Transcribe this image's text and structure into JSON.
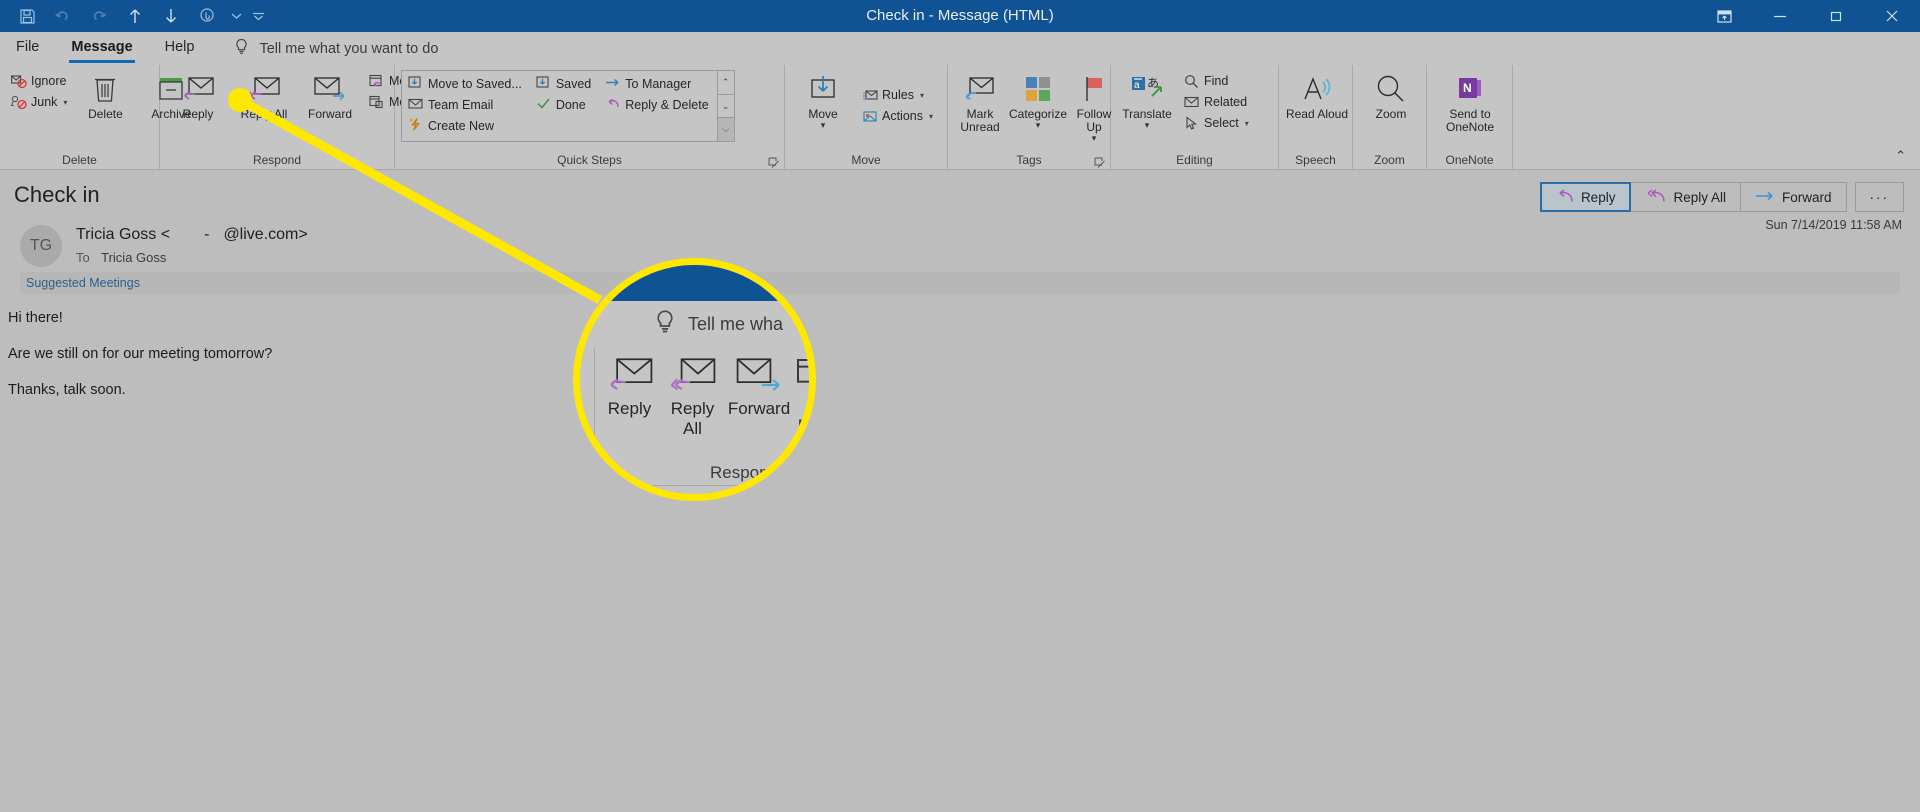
{
  "window": {
    "title": "Check in  -  Message (HTML)",
    "quick_access": [
      {
        "name": "save-icon",
        "label": "Save"
      },
      {
        "name": "undo-icon",
        "label": "Undo"
      },
      {
        "name": "redo-icon",
        "label": "Redo"
      },
      {
        "name": "previous-item-icon",
        "label": "Previous Item"
      },
      {
        "name": "next-item-icon",
        "label": "Next Item"
      },
      {
        "name": "touch-mode-icon",
        "label": "Touch/Mouse Mode"
      }
    ],
    "controls": [
      {
        "name": "ribbon-display-options-button",
        "label": "Ribbon Display Options"
      },
      {
        "name": "minimize-button",
        "label": "Minimize"
      },
      {
        "name": "maximize-button",
        "label": "Maximize"
      },
      {
        "name": "close-button",
        "label": "Close"
      }
    ]
  },
  "tabs": [
    {
      "label": "File",
      "active": false
    },
    {
      "label": "Message",
      "active": true
    },
    {
      "label": "Help",
      "active": false
    }
  ],
  "tellme": {
    "placeholder": "Tell me what you want to do",
    "icon": "lightbulb-icon"
  },
  "ribbon": {
    "collapse_label": "⌃",
    "groups": [
      {
        "label": "Delete",
        "small_buttons": [
          {
            "label": "Ignore",
            "icon": "ignore-icon",
            "caret": false
          },
          {
            "label": "Junk",
            "icon": "junk-icon",
            "caret": true
          }
        ],
        "big_buttons": [
          {
            "label": "Delete",
            "icon": "trash-icon",
            "caret": false
          },
          {
            "label": "Archive",
            "icon": "archive-icon",
            "caret": false
          }
        ]
      },
      {
        "label": "Respond",
        "big_buttons": [
          {
            "label": "Reply",
            "icon": "reply-envelope-icon",
            "caret": false
          },
          {
            "label": "Reply All",
            "icon": "reply-all-envelope-icon",
            "caret": false
          },
          {
            "label": "Forward",
            "icon": "forward-envelope-icon",
            "caret": false
          }
        ],
        "small_buttons": [
          {
            "label": "Meeting",
            "icon": "meeting-calendar-icon",
            "caret": false
          },
          {
            "label": "More",
            "icon": "more-calendar-icon",
            "caret": true
          }
        ]
      },
      {
        "label": "Quick Steps",
        "gallery_column_1": [
          {
            "label": "Move to Saved...",
            "icon": "move-to-folder-icon"
          },
          {
            "label": "Team Email",
            "icon": "envelope-icon"
          },
          {
            "label": "Create New",
            "icon": "create-new-lightning-icon"
          }
        ],
        "gallery_column_2": [
          {
            "label": "Saved",
            "icon": "move-to-folder-icon"
          },
          {
            "label": "Done",
            "icon": "checkmark-icon"
          }
        ],
        "gallery_column_3": [
          {
            "label": "To Manager",
            "icon": "arrow-right-icon"
          },
          {
            "label": "Reply & Delete",
            "icon": "reply-delete-icon"
          }
        ],
        "scroll": [
          "⌃",
          "⌄",
          "⌵"
        ],
        "has_launcher": true
      },
      {
        "label": "Move",
        "big_buttons": [
          {
            "label": "Move",
            "icon": "move-folder-icon",
            "caret": true
          }
        ],
        "small_buttons": [
          {
            "label": "Rules",
            "icon": "rules-icon",
            "caret": true
          },
          {
            "label": "Actions",
            "icon": "actions-icon",
            "caret": true
          }
        ]
      },
      {
        "label": "Tags",
        "big_buttons": [
          {
            "label": "Mark Unread",
            "icon": "mark-unread-icon",
            "caret": false
          },
          {
            "label": "Categorize",
            "icon": "categorize-icon",
            "caret": true
          },
          {
            "label": "Follow Up",
            "icon": "follow-up-flag-icon",
            "caret": true
          }
        ],
        "has_launcher": true
      },
      {
        "label": "Editing",
        "big_buttons": [
          {
            "label": "Translate",
            "icon": "translate-icon",
            "caret": true
          }
        ],
        "small_buttons": [
          {
            "label": "Find",
            "icon": "search-icon",
            "caret": false
          },
          {
            "label": "Related",
            "icon": "related-envelope-icon",
            "caret": false
          },
          {
            "label": "Select",
            "icon": "select-cursor-icon",
            "caret": true
          }
        ]
      },
      {
        "label": "Speech",
        "big_buttons": [
          {
            "label": "Read Aloud",
            "icon": "read-aloud-icon",
            "caret": false
          }
        ]
      },
      {
        "label": "Zoom",
        "big_buttons": [
          {
            "label": "Zoom",
            "icon": "magnifier-icon",
            "caret": false
          }
        ]
      },
      {
        "label": "OneNote",
        "big_buttons": [
          {
            "label": "Send to OneNote",
            "icon": "onenote-icon",
            "caret": false
          }
        ]
      }
    ]
  },
  "message": {
    "subject": "Check in",
    "avatar_initials": "TG",
    "sender_name": "Tricia Goss",
    "sender_email_open": "<",
    "sender_email_sep": "-",
    "sender_email_domain": "@live.com>",
    "to_label": "To",
    "to_value": "Tricia Goss",
    "suggested_meetings": "Suggested Meetings",
    "date": "Sun 7/14/2019 11:58 AM",
    "body": [
      "Hi there!",
      "Are we still on for our meeting tomorrow?",
      "Thanks, talk soon."
    ],
    "actions": [
      {
        "label": "Reply",
        "icon": "reply-icon",
        "selected": true
      },
      {
        "label": "Reply All",
        "icon": "reply-all-icon",
        "selected": false
      },
      {
        "label": "Forward",
        "icon": "forward-icon",
        "selected": false
      }
    ],
    "more_actions": "···"
  },
  "callout": {
    "magnified_tellme": "Tell me wha",
    "magnified_group_label": "Respond",
    "magnified_buttons": [
      {
        "label": "Reply",
        "icon": "reply-envelope-icon"
      },
      {
        "label": "Reply All",
        "icon": "reply-all-envelope-icon"
      },
      {
        "label": "Forward",
        "icon": "forward-envelope-icon"
      }
    ],
    "highlight_color": "#ffe800"
  },
  "colors": {
    "titlebar": "#0f5394",
    "ribbon": "#c5c5c5",
    "pane": "#bdbdbd",
    "accent": "#1268b3",
    "reply_arrow": "#b05fc0",
    "forward_arrow": "#3f9fd0",
    "highlight": "#ffe800"
  }
}
